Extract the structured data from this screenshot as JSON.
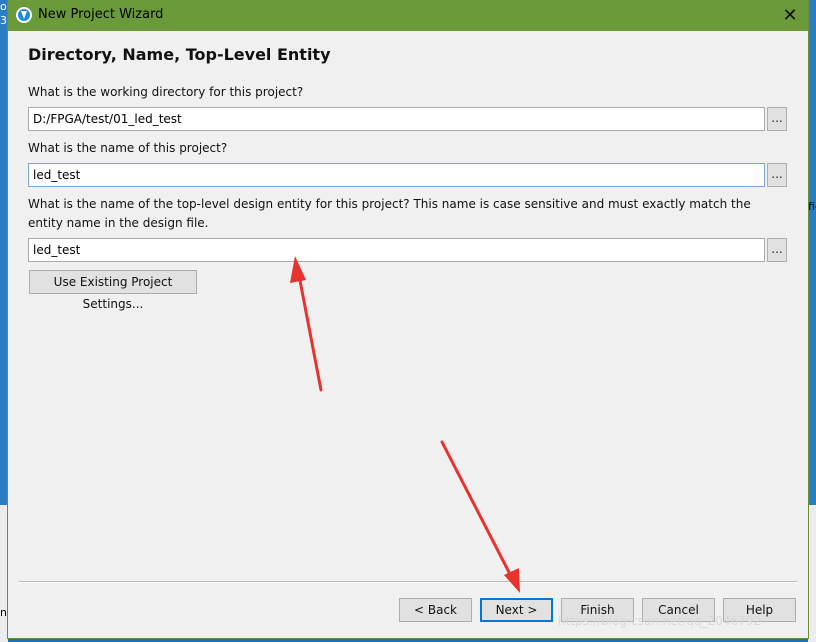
{
  "background": {
    "left_fragments": [
      "o",
      "3"
    ],
    "right_fragments": [
      "fic"
    ],
    "left_bottom_fragment": "nc"
  },
  "window": {
    "title": "New Project Wizard",
    "close_label": "✕"
  },
  "page": {
    "heading": "Directory, Name, Top-Level Entity"
  },
  "fields": {
    "directory": {
      "label": "What is the working directory for this project?",
      "value": "D:/FPGA/test/01_led_test",
      "browse_label": "..."
    },
    "project_name": {
      "label": "What is the name of this project?",
      "value": "led_test",
      "browse_label": "..."
    },
    "top_entity": {
      "label": "What is the name of the top-level design entity for this project? This name is case sensitive and must exactly match the entity name in the design file.",
      "value": "led_test",
      "browse_label": "..."
    }
  },
  "use_existing_label": "Use Existing Project Settings...",
  "footer": {
    "back_label": "< Back",
    "next_label": "Next >",
    "finish_label": "Finish",
    "cancel_label": "Cancel",
    "help_label": "Help"
  },
  "watermark": "https://blog.csdn.net/qq_2046792",
  "annotation_color": "#e8322d"
}
